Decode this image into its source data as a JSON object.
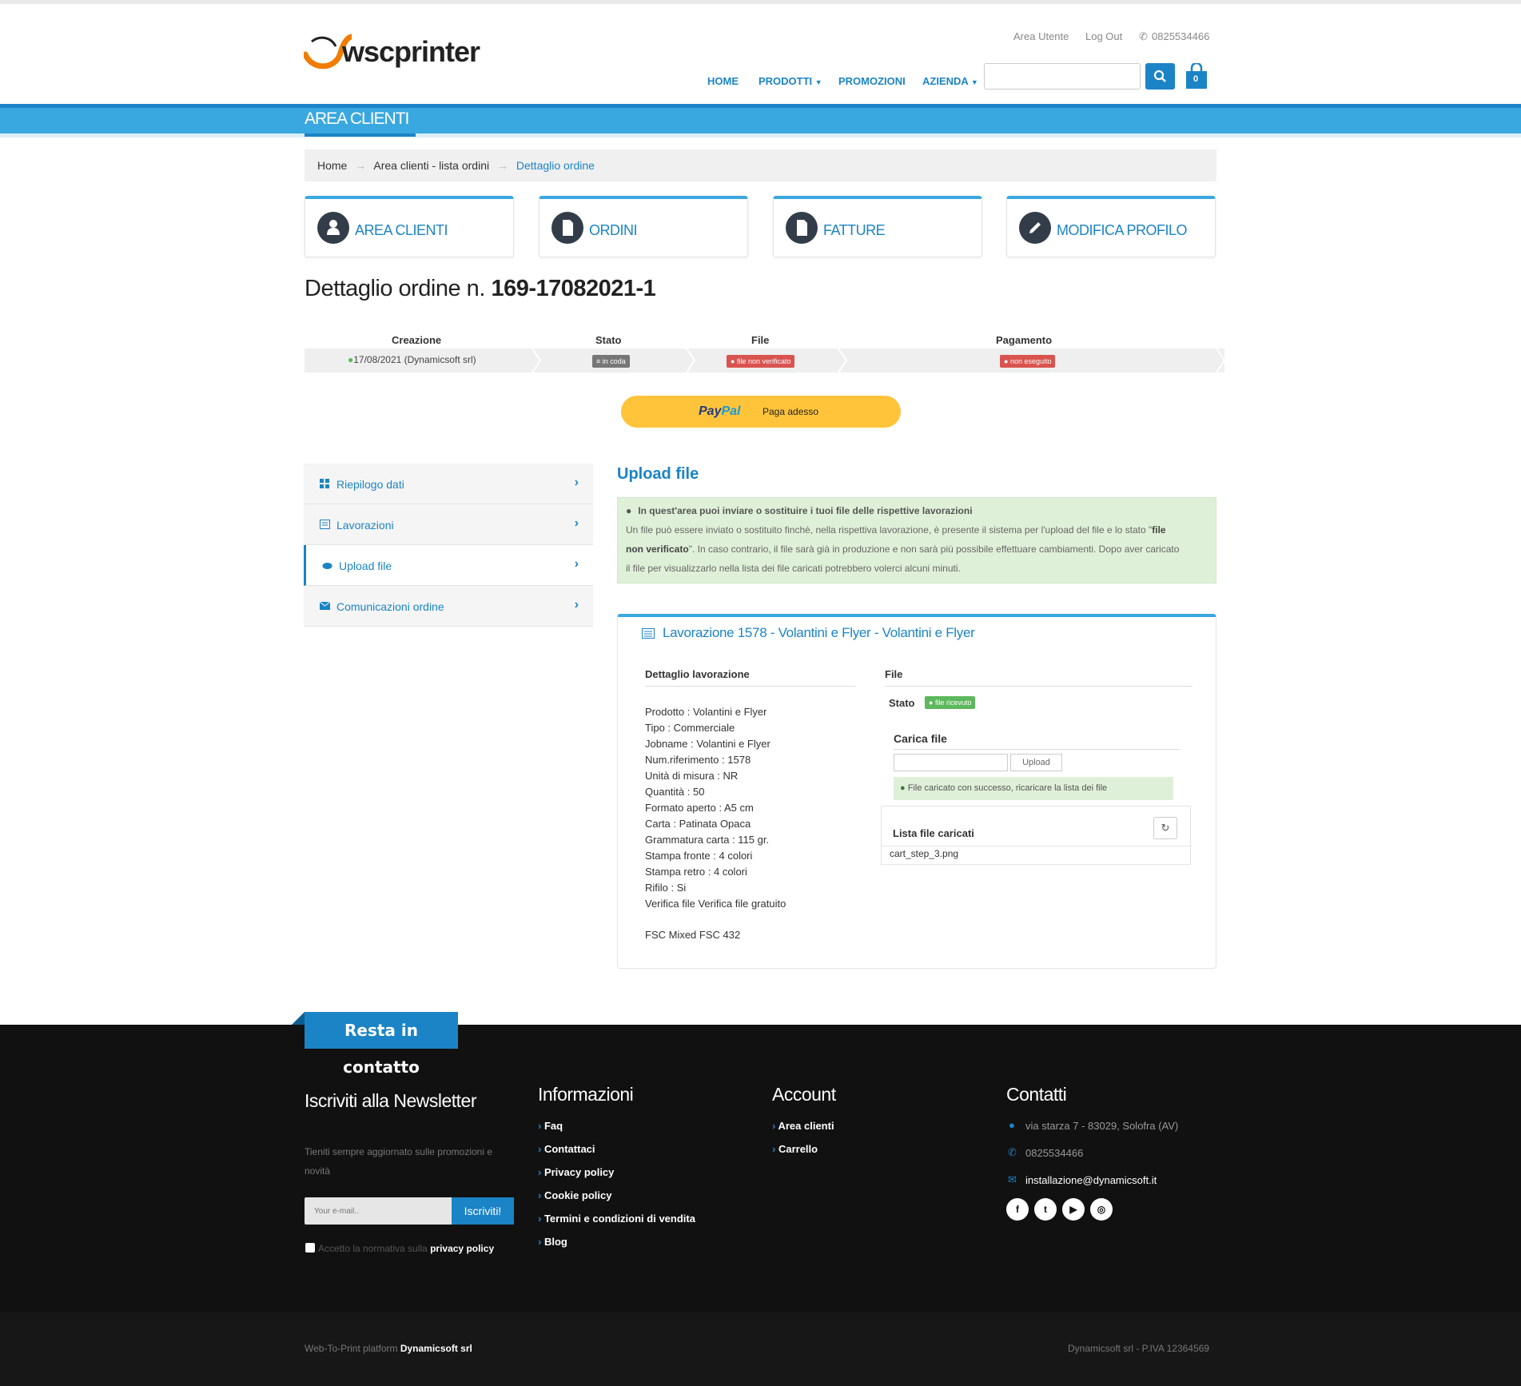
{
  "header": {
    "logo_text": "wscprinter",
    "top_links": [
      "Area Utente",
      "Log Out"
    ],
    "phone": "0825534466",
    "nav": [
      "HOME",
      "PRODOTTI",
      "PROMOZIONI",
      "AZIENDA"
    ],
    "cart_count": "0",
    "search_placeholder": ""
  },
  "bar": {
    "title": "AREA CLIENTI"
  },
  "breadcrumb": [
    "Home",
    "Area clienti - lista ordini",
    "Dettaglio ordine"
  ],
  "cards": [
    "AREA CLIENTI",
    "ORDINI",
    "FATTURE",
    "MODIFICA PROFILO"
  ],
  "order": {
    "title_prefix": "Dettaglio ordine n.",
    "number": "169-17082021-1"
  },
  "steps": {
    "headers": [
      "Creazione",
      "Stato",
      "File",
      "Pagamento"
    ],
    "creazione": "17/08/2021 (Dynamicsoft srl)",
    "stato": "in coda",
    "file": "file non verificato",
    "pagamento": "non eseguito"
  },
  "paypal": {
    "brand1": "Pay",
    "brand2": "Pal",
    "label": "Paga adesso"
  },
  "sidebar": [
    "Riepilogo dati",
    "Lavorazioni",
    "Upload file",
    "Comunicazioni ordine"
  ],
  "upload": {
    "title": "Upload file",
    "info_title": "In quest'area puoi inviare o sostituire i tuoi file delle rispettive lavorazioni",
    "info_l1a": "Un file può essere inviato o sostituito finchè, nella rispettiva lavorazione, è presente il sistema per l'upload del file e lo stato \"",
    "info_l1b": "file",
    "info_l2a": "non verificato",
    "info_l2b": "\". In caso contrario, il file sarà già in produzione e non sarà più possibile effettuare cambiamenti. Dopo aver caricato",
    "info_l3": "il file per visualizzarlo nella lista dei file caricati potrebbero volerci alcuni minuti."
  },
  "lavorazione": {
    "title": "Lavorazione 1578 - Volantini e Flyer - Volantini e Flyer",
    "det_title": "Dettaglio lavorazione",
    "details": [
      "Prodotto : Volantini e Flyer",
      "Tipo : Commerciale",
      "Jobname : Volantini e Flyer",
      "Num.riferimento : 1578",
      "Unità di misura : NR",
      "Quantità : 50",
      "Formato aperto : A5 cm",
      "Carta : Patinata Opaca",
      "Grammatura carta : 115 gr.",
      "Stampa fronte : 4 colori",
      "Stampa retro : 4 colori",
      "Rifilo : Si",
      "Verifica file Verifica file gratuito"
    ],
    "fsc": "FSC Mixed FSC 432",
    "file_title": "File",
    "stato_label": "Stato",
    "stato_badge": "file ricevuto",
    "carica_title": "Carica file",
    "upload_btn": "Upload",
    "success": "File caricato con successo, ricaricare la lista dei file",
    "list_title": "Lista file caricati",
    "files": [
      "cart_step_3.png"
    ]
  },
  "footer": {
    "tab": "Resta in contatto",
    "newsletter_title": "Iscriviti alla Newsletter",
    "newsletter_text1": "Tieniti sempre aggiornato sulle promozioni e",
    "newsletter_text2": "novità",
    "email_placeholder": "Your e-mail..",
    "subscribe": "Iscriviti!",
    "privacy_text": "Accetto la normativa sulla",
    "privacy_link": "privacy policy",
    "info_title": "Informazioni",
    "info_links": [
      "Faq",
      "Contattaci",
      "Privacy policy",
      "Cookie policy",
      "Termini e condizioni di vendita",
      "Blog"
    ],
    "account_title": "Account",
    "account_links": [
      "Area clienti",
      "Carrello"
    ],
    "contact_title": "Contatti",
    "address": "via starza 7 - 83029, Solofra (AV)",
    "phone": "0825534466",
    "email": "installazione@dynamicsoft.it",
    "social_icons": [
      "facebook-icon",
      "twitter-icon",
      "youtube-icon",
      "instagram-icon"
    ]
  },
  "bottom": {
    "left_text": "Web-To-Print platform",
    "left_brand": "Dynamicsoft srl",
    "right": "Dynamicsoft srl - P.IVA 12364569"
  },
  "colors": {
    "accent": "#1b84c6",
    "bar": "#3aa8e0",
    "footer": "#111111",
    "success": "#5cb85c",
    "danger": "#d9534f"
  }
}
